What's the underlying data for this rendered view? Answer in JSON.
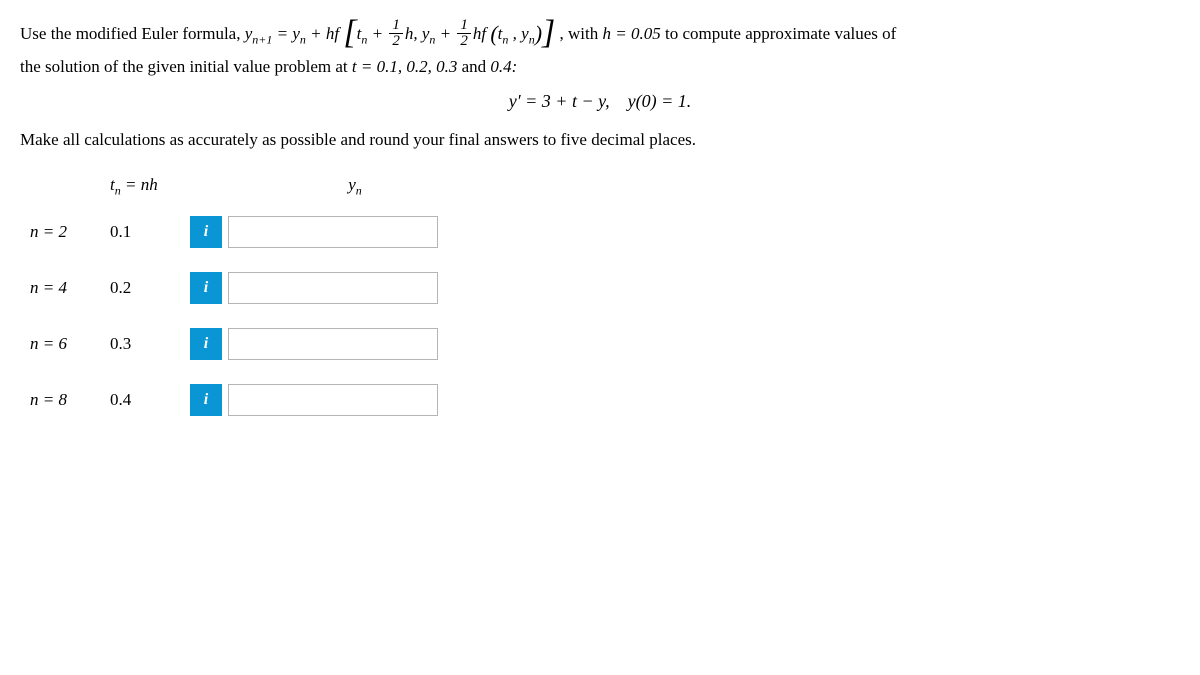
{
  "problem": {
    "intro_pre": "Use the modified Euler formula, ",
    "intro_post": ", with ",
    "h_eq": "h = 0.05",
    "intro_end": " to compute approximate values of",
    "line2_pre": "the solution of the given initial value problem at ",
    "t_values": "t = 0.1, 0.2, 0.3",
    "line2_and": " and ",
    "line2_last": "0.4:",
    "ode": "y′ = 3 + t − y,    y(0) = 1.",
    "instruction": "Make all calculations as accurately as possible and round your final answers to five decimal places."
  },
  "headers": {
    "tn": "tₙ = nh",
    "yn": "yₙ"
  },
  "rows": [
    {
      "n": "n = 2",
      "t": "0.1",
      "y": ""
    },
    {
      "n": "n = 4",
      "t": "0.2",
      "y": ""
    },
    {
      "n": "n = 6",
      "t": "0.3",
      "y": ""
    },
    {
      "n": "n = 8",
      "t": "0.4",
      "y": ""
    }
  ],
  "info_label": "i"
}
